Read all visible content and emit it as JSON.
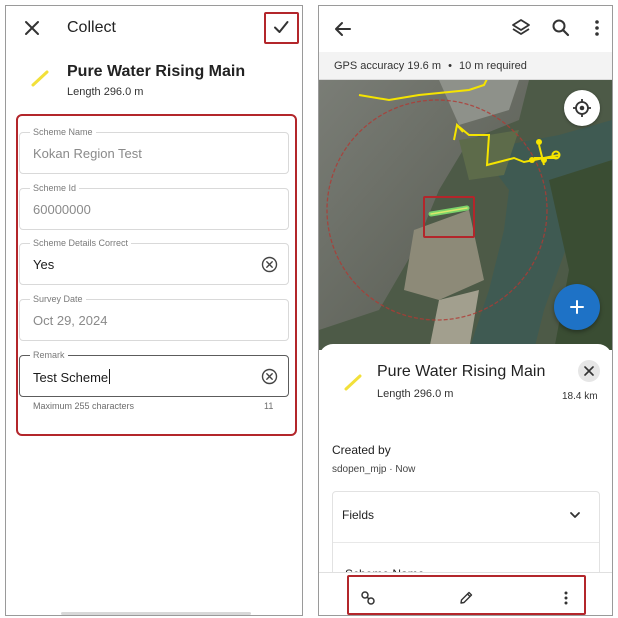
{
  "left_screen": {
    "header": {
      "title": "Collect"
    },
    "feature": {
      "name": "Pure Water Rising Main",
      "length": "Length 296.0 m"
    },
    "form": {
      "fields": [
        {
          "label": "Scheme Name",
          "value": "Kokan Region Test"
        },
        {
          "label": "Scheme Id",
          "value": "60000000"
        },
        {
          "label": "Scheme Details Correct",
          "value": "Yes"
        },
        {
          "label": "Survey Date",
          "value": "Oct 29, 2024"
        },
        {
          "label": "Remark",
          "value": "Test Scheme"
        }
      ],
      "remark_helper": "Maximum 255 characters",
      "remark_count": "11"
    }
  },
  "right_screen": {
    "gps": {
      "accuracy": "GPS accuracy 19.6 m",
      "separator": "•",
      "required": "10 m required"
    },
    "sheet": {
      "feature_name": "Pure Water Rising Main",
      "length": "Length 296.0 m",
      "distance": "18.4 km",
      "created_by_label": "Created by",
      "created_by_value": "sdopen_mjp · Now",
      "fields_label": "Fields",
      "first_field_label": "Scheme Name"
    }
  },
  "colors": {
    "highlight_red": "#b3262b",
    "feature_yellow": "#f2e03a",
    "fab_blue": "#1e72c6",
    "line_yellow": "#f5e400",
    "green_line": "#7bd36b"
  },
  "icons": [
    "close-icon",
    "check-icon",
    "line-feature-icon",
    "clear-icon",
    "back-arrow-icon",
    "layers-icon",
    "search-icon",
    "more-vert-icon",
    "locate-icon",
    "plus-icon",
    "chevron-down-icon",
    "link-icon",
    "edit-pencil-icon"
  ]
}
